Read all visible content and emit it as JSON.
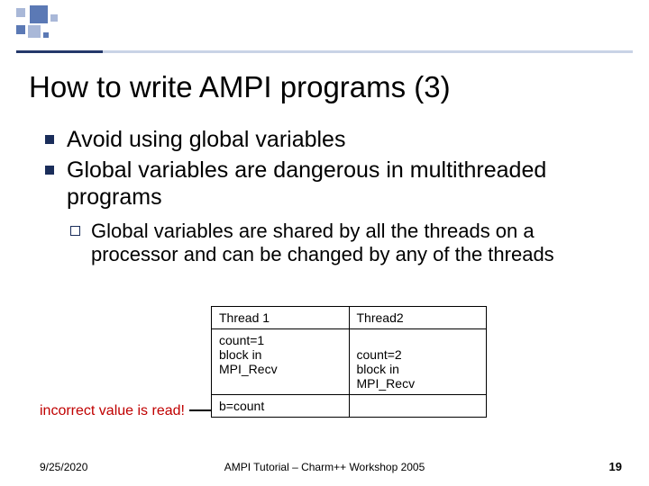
{
  "title": "How to write AMPI programs (3)",
  "bullets": [
    "Avoid using global variables",
    "Global variables are dangerous in multithreaded programs"
  ],
  "sub_bullet": "Global variables are shared by all the threads on a processor and can be changed by any of the threads",
  "table": {
    "head": [
      "Thread 1",
      "Thread2"
    ],
    "row1": [
      "count=1\nblock in\nMPI_Recv",
      "\ncount=2\nblock in\nMPI_Recv"
    ],
    "foot": [
      "b=count",
      ""
    ]
  },
  "incorrect_label": "incorrect value is read!",
  "footer": {
    "date": "9/25/2020",
    "mid": "AMPI Tutorial – Charm++ Workshop 2005",
    "page": "19"
  }
}
